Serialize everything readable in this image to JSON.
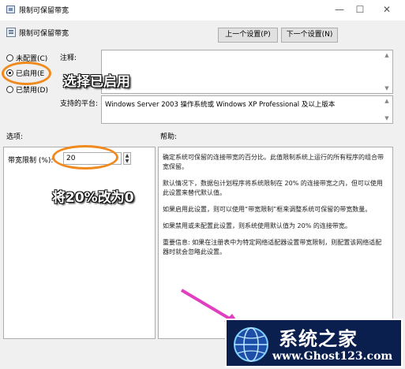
{
  "window": {
    "title": "限制可保留带宽",
    "min_label": "—",
    "max_label": "☐",
    "close_label": "✕"
  },
  "header": {
    "policy_name": "限制可保留带宽",
    "prev_button": "上一个设置(P)",
    "next_button": "下一个设置(N)"
  },
  "radios": [
    {
      "label": "未配置(C)",
      "checked": false
    },
    {
      "label": "已启用(E",
      "checked": true
    },
    {
      "label": "已禁用(D)",
      "checked": false
    }
  ],
  "comment": {
    "label": "注释:",
    "value": ""
  },
  "supported": {
    "label": "支持的平台:",
    "value": "Windows Server 2003 操作系统或 Windows XP Professional 及以上版本"
  },
  "options": {
    "label": "选项:",
    "bandwidth_label": "带宽限制 (%):",
    "bandwidth_value": "20"
  },
  "help": {
    "label": "帮助:",
    "paragraphs": [
      "确定系统可保留的连接带宽的百分比。此值限制系统上运行的所有程序的组合带宽保留。",
      "默认情况下，数据包计划程序将系统限制在 20% 的连接带宽之内，但可以使用此设置来替代默认值。",
      "如果启用此设置，则可以使用“带宽限制”框来调整系统可保留的带宽数量。",
      "如果禁用或未配置此设置，则系统使用默认值为 20% 的连接带宽。",
      "重要信息: 如果在注册表中为特定网络适配器设置带宽限制，则配置该网络适配器时就会忽略此设置。"
    ]
  },
  "annotations": {
    "select_enabled": "选择已启用",
    "change_value": "将20%改为0"
  },
  "colors": {
    "annotation_ellipse": "#f08a1e",
    "arrow": "#e040c0",
    "logo_bg": "#0b1f4e"
  },
  "watermark": {
    "name": "系统之家",
    "url": "www.Ghost123.com"
  }
}
